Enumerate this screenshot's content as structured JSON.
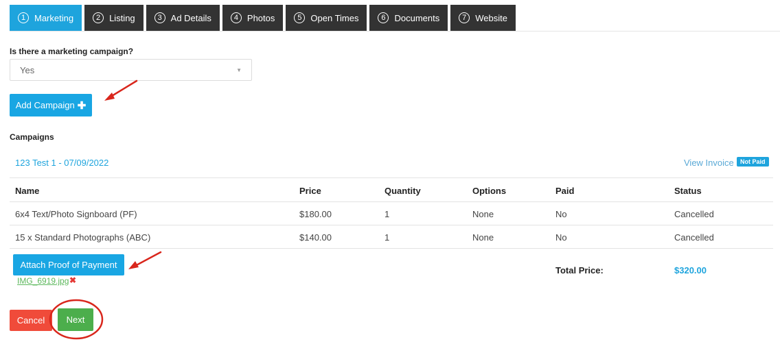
{
  "tabs": [
    {
      "num": "1",
      "label": "Marketing",
      "active": true
    },
    {
      "num": "2",
      "label": "Listing"
    },
    {
      "num": "3",
      "label": "Ad Details"
    },
    {
      "num": "4",
      "label": "Photos"
    },
    {
      "num": "5",
      "label": "Open Times"
    },
    {
      "num": "6",
      "label": "Documents"
    },
    {
      "num": "7",
      "label": "Website"
    }
  ],
  "campaign_question": {
    "label": "Is there a marketing campaign?",
    "selected": "Yes",
    "caret_icon": "caret-down-icon"
  },
  "add_campaign": {
    "label": "Add Campaign",
    "icon": "plus-icon"
  },
  "campaigns_title": "Campaigns",
  "campaign": {
    "heading": "123 Test 1 - 07/09/2022",
    "view_invoice": "View Invoice",
    "payment_badge": "Not Paid"
  },
  "table": {
    "headers": [
      "Name",
      "Price",
      "Quantity",
      "Options",
      "Paid",
      "Status"
    ],
    "rows": [
      [
        "6x4 Text/Photo Signboard (PF)",
        "$180.00",
        "1",
        "None",
        "No",
        "Cancelled"
      ],
      [
        "15 x Standard Photographs (ABC)",
        "$140.00",
        "1",
        "None",
        "No",
        "Cancelled"
      ]
    ]
  },
  "attach_proof": {
    "label": "Attach Proof of Payment"
  },
  "attachment": {
    "filename": "IMG_6919.jpg",
    "remove_icon": "✖"
  },
  "total": {
    "label": "Total Price:",
    "value": "$320.00"
  },
  "actions": {
    "cancel": "Cancel",
    "next": "Next"
  },
  "colors": {
    "primary_blue": "#1ea4dd",
    "tab_dark": "#333333",
    "danger_red": "#f04b3a",
    "success_green": "#4cae4c",
    "annotation_red": "#d9261c"
  }
}
